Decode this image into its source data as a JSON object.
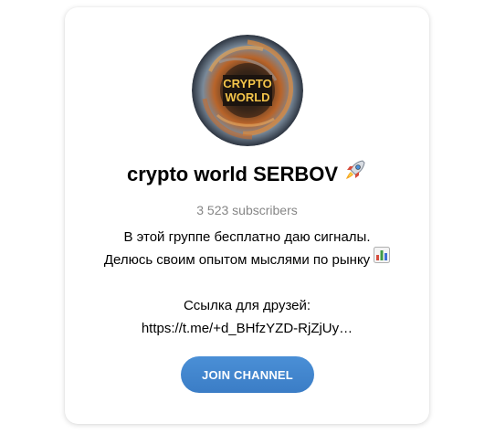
{
  "channel": {
    "name": "crypto world SERBOV",
    "name_emoji": "rocket-icon",
    "subscribers": "3 523 subscribers",
    "avatar_text": [
      "CRYPTO",
      "WORLD"
    ],
    "description_lines": [
      "В этой группе бесплатно даю сигналы.",
      "Делюсь своим опытом мыслями по рынку"
    ],
    "description_emoji": "bar-chart-icon",
    "link_label": "Ссылка для друзей:",
    "link_url": "https://t.me/+d_BHfzYZD-RjZjUy…"
  },
  "actions": {
    "join_label": "JOIN CHANNEL"
  },
  "colors": {
    "accent": "#3b7dc6",
    "subtitle": "#868686",
    "text": "#000000"
  }
}
